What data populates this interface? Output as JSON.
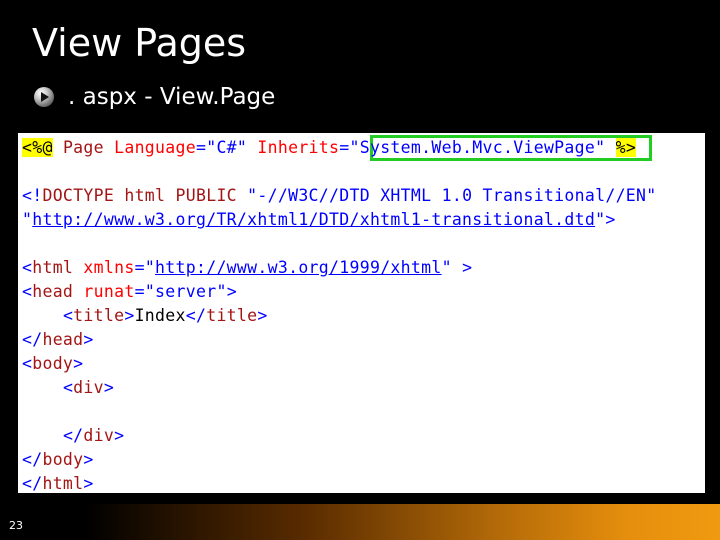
{
  "slide": {
    "title": "View Pages",
    "bullet": ". aspx - View.Page",
    "page_number": "23"
  },
  "code": {
    "l1": {
      "open": "<%@",
      "kw_page": "Page",
      "attr_language": "Language",
      "eq1": "=",
      "val_language": "\"C#\"",
      "attr_inherits": "Inherits",
      "eq2": "=",
      "val_inherits": "\"System.Web.Mvc.ViewPage\"",
      "close": "%>"
    },
    "l2": {
      "open": "<!",
      "tag": "DOCTYPE html PUBLIC",
      "val": "\"-//W3C//DTD XHTML 1.0 Transitional//EN\""
    },
    "l3": {
      "q1": "\"",
      "link": "http://www.w3.org/TR/xhtml1/DTD/xhtml1-transitional.dtd",
      "q2": "\"",
      "close": ">"
    },
    "l4": {
      "open": "<",
      "tag": "html",
      "attr": "xmlns",
      "eq": "=",
      "q1": "\"",
      "link": "http://www.w3.org/1999/xhtml",
      "q2": "\"",
      "close": ">"
    },
    "l5": {
      "open": "<",
      "tag": "head",
      "attr": "runat",
      "eq": "=",
      "val": "\"server\"",
      "close": ">"
    },
    "l6": {
      "open": "<",
      "tag": "title",
      "gt": ">",
      "text": "Index",
      "close_open": "</",
      "close_tag": "title",
      "close": ">"
    },
    "l7": {
      "open": "</",
      "tag": "head",
      "close": ">"
    },
    "l8": {
      "open": "<",
      "tag": "body",
      "close": ">"
    },
    "l9": {
      "open": "<",
      "tag": "div",
      "close": ">"
    },
    "l10": {
      "open": "</",
      "tag": "div",
      "close": ">"
    },
    "l11": {
      "open": "</",
      "tag": "body",
      "close": ">"
    },
    "l12": {
      "open": "</",
      "tag": "html",
      "close": ">"
    }
  }
}
